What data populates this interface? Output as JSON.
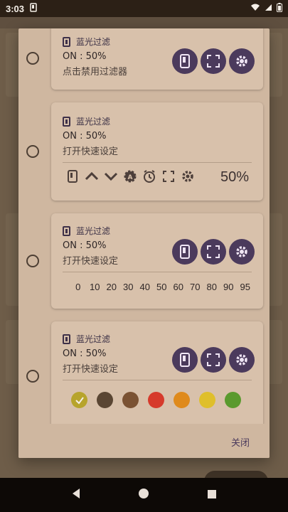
{
  "status_bar": {
    "time": "3:03"
  },
  "app_name": "蓝光过滤",
  "cards": [
    {
      "line1": "ON : 50%",
      "line2": "点击禁用过滤器"
    },
    {
      "line1": "ON : 50%",
      "line2": "打开快速设定",
      "percent": "50%"
    },
    {
      "line1": "ON : 50%",
      "line2": "打开快速设定",
      "levels": [
        "0",
        "10",
        "20",
        "30",
        "40",
        "50",
        "60",
        "70",
        "80",
        "90",
        "95"
      ]
    },
    {
      "line1": "ON : 50%",
      "line2": "打开快速设定",
      "colors": [
        "#b7a42c",
        "#5a4633",
        "#7a5233",
        "#d63a2b",
        "#df8a1c",
        "#dfbf2b",
        "#5a9a2e"
      ]
    }
  ],
  "dialog": {
    "close_label": "关闭"
  },
  "icons": {
    "screen": "screen-filter-icon",
    "fullscreen": "fullscreen-icon",
    "settings": "gear-icon",
    "up": "chevron-up-icon",
    "down": "chevron-down-icon",
    "auto": "auto-brightness-icon",
    "alarm": "alarm-icon"
  }
}
